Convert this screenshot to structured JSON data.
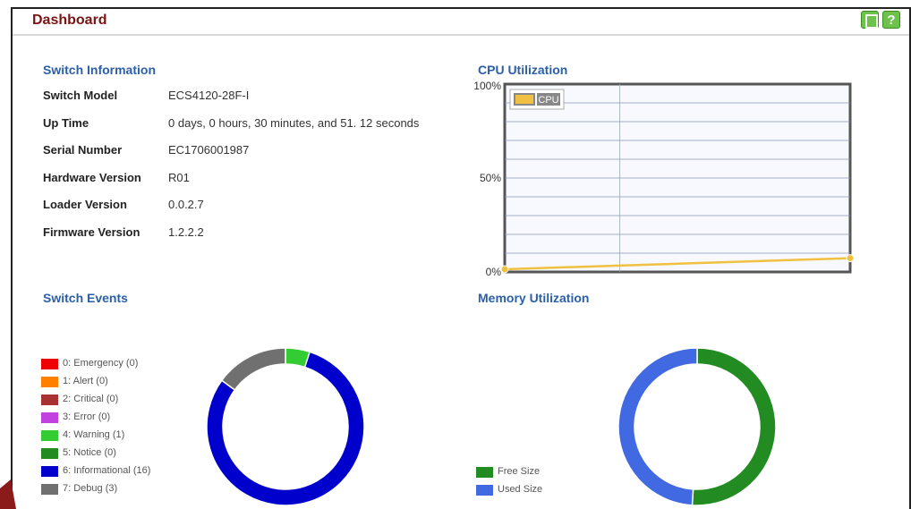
{
  "page": {
    "title": "Dashboard"
  },
  "icons": {
    "save": "save-icon",
    "help": "help-icon"
  },
  "switch_info": {
    "title": "Switch Information",
    "rows": [
      {
        "label": "Switch Model",
        "value": "ECS4120-28F-I"
      },
      {
        "label": "Up Time",
        "value": "0 days, 0 hours, 30 minutes, and 51. 12 seconds"
      },
      {
        "label": "Serial Number",
        "value": "EC1706001987"
      },
      {
        "label": "Hardware Version",
        "value": "R01"
      },
      {
        "label": "Loader Version",
        "value": "0.0.2.7"
      },
      {
        "label": "Firmware Version",
        "value": "1.2.2.2"
      }
    ]
  },
  "cpu": {
    "title": "CPU Utilization",
    "chart_data": {
      "type": "line",
      "title": "CPU Utilization",
      "y_ticks": [
        "100%",
        "50%",
        "0%"
      ],
      "ylim": [
        0,
        100
      ],
      "series": [
        {
          "name": "CPU",
          "color": "#f0c040",
          "values": [
            0,
            6
          ]
        }
      ],
      "legend_position": "top-left",
      "grid": true
    }
  },
  "events": {
    "title": "Switch Events",
    "chart_data": {
      "type": "pie",
      "categories": [
        "0: Emergency (0)",
        "1: Alert (0)",
        "2: Critical (0)",
        "3: Error (0)",
        "4: Warning (1)",
        "5: Notice (0)",
        "6: Informational (16)",
        "7: Debug (3)"
      ],
      "values": [
        0,
        0,
        0,
        0,
        1,
        0,
        16,
        3
      ],
      "colors": [
        "#ee0000",
        "#ff8000",
        "#a83232",
        "#c040e0",
        "#33cc33",
        "#228b22",
        "#0000cc",
        "#707070"
      ],
      "legend_position": "left"
    }
  },
  "memory": {
    "title": "Memory Utilization",
    "chart_data": {
      "type": "pie",
      "categories": [
        "Free Size",
        "Used Size"
      ],
      "values": [
        51,
        49
      ],
      "colors": [
        "#228b22",
        "#4169e1"
      ],
      "legend_position": "bottom-left"
    }
  }
}
